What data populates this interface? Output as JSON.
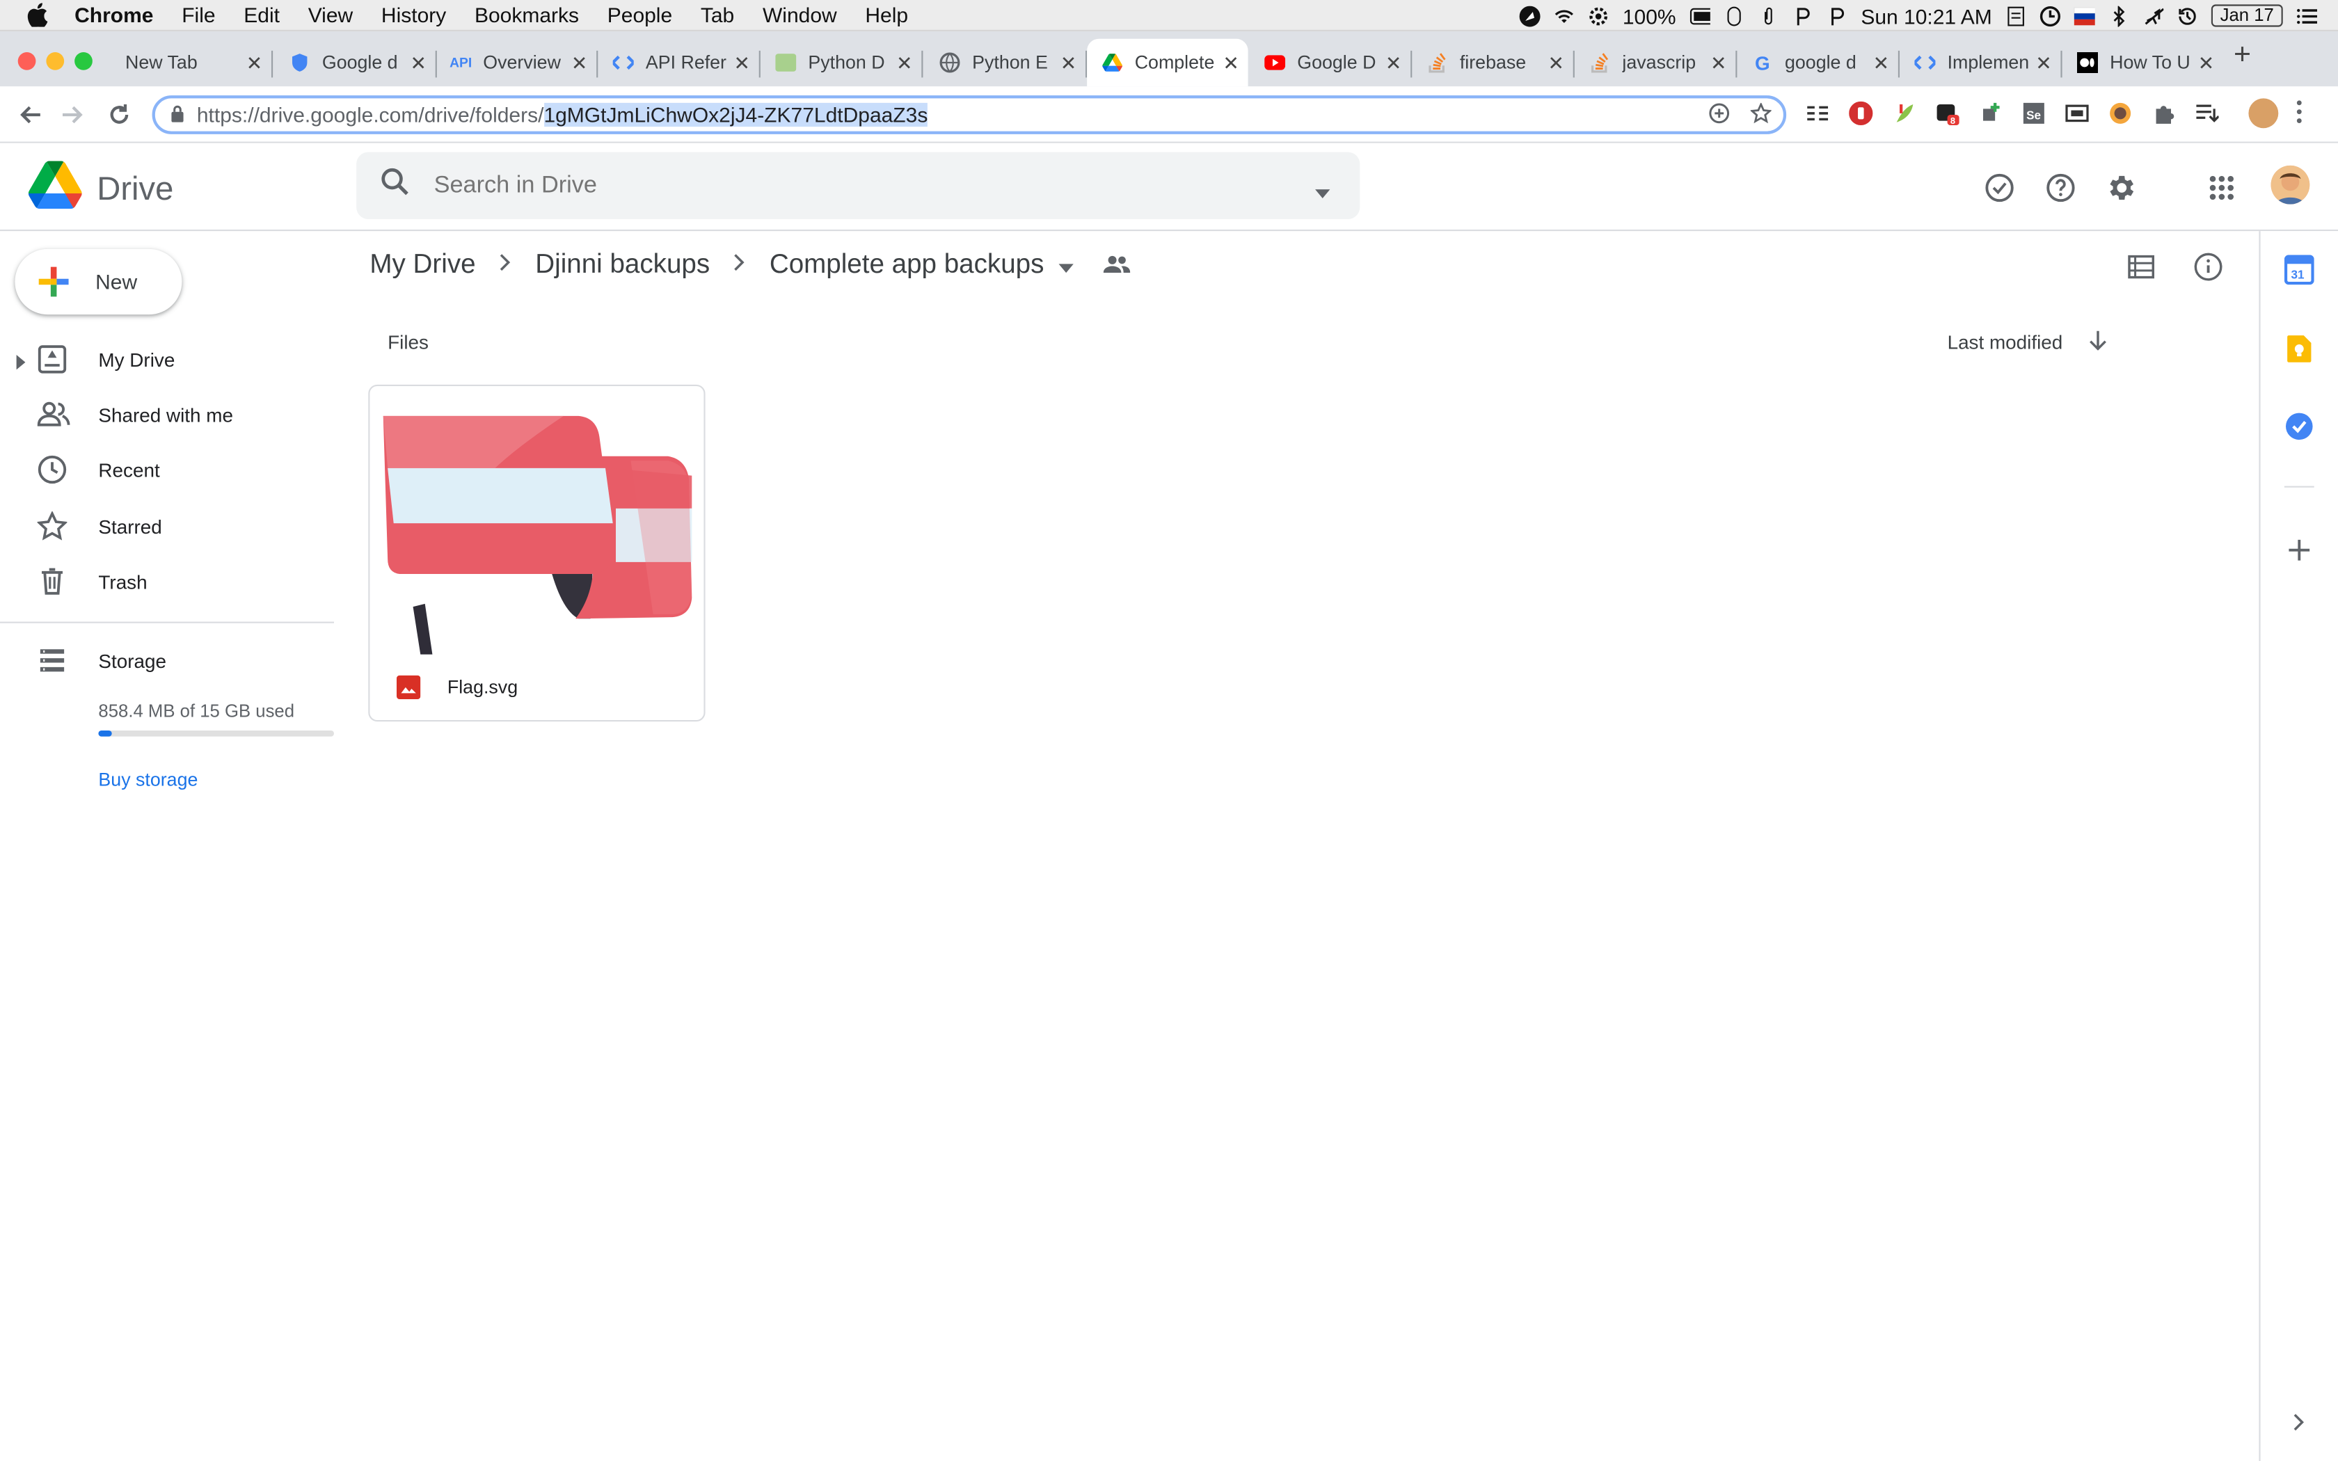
{
  "mac_menu": {
    "items": [
      "Chrome",
      "File",
      "Edit",
      "View",
      "History",
      "Bookmarks",
      "People",
      "Tab",
      "Window",
      "Help"
    ],
    "battery": "100%",
    "clock": "Sun 10:21 AM",
    "date_badge": "Jan 17"
  },
  "tabs": [
    {
      "label": "New Tab"
    },
    {
      "label": "Google d"
    },
    {
      "label": "Overview"
    },
    {
      "label": "API Refer"
    },
    {
      "label": "Python D"
    },
    {
      "label": "Python E"
    },
    {
      "label": "Complete",
      "active": true
    },
    {
      "label": "Google D"
    },
    {
      "label": "firebase"
    },
    {
      "label": "javascrip"
    },
    {
      "label": "google d"
    },
    {
      "label": "Implemen"
    },
    {
      "label": "How To U"
    }
  ],
  "address_bar": {
    "url_base": "https://drive.google.com/drive/folders/",
    "url_selected": "1gMGtJmLiChwOx2jJ4-ZK77LdtDpaaZ3s"
  },
  "drive": {
    "product_name": "Drive",
    "search_placeholder": "Search in Drive",
    "new_button": "New",
    "nav": {
      "my_drive": "My Drive",
      "shared": "Shared with me",
      "recent": "Recent",
      "starred": "Starred",
      "trash": "Trash",
      "storage": "Storage"
    },
    "storage_used": "858.4 MB of 15 GB used",
    "storage_fraction": 0.057,
    "buy_storage": "Buy storage",
    "breadcrumb": {
      "root": "My Drive",
      "parent": "Djinni backups",
      "current": "Complete app backups"
    },
    "section_label": "Files",
    "sort_label": "Last modified",
    "files": [
      {
        "name": "Flag.svg",
        "type_icon": "image-file-icon"
      }
    ]
  },
  "colors": {
    "accent": "#1a73e8",
    "flag_red": "#e85c67",
    "flag_light": "#d6ecf7",
    "file_icon_red": "#d93025"
  }
}
